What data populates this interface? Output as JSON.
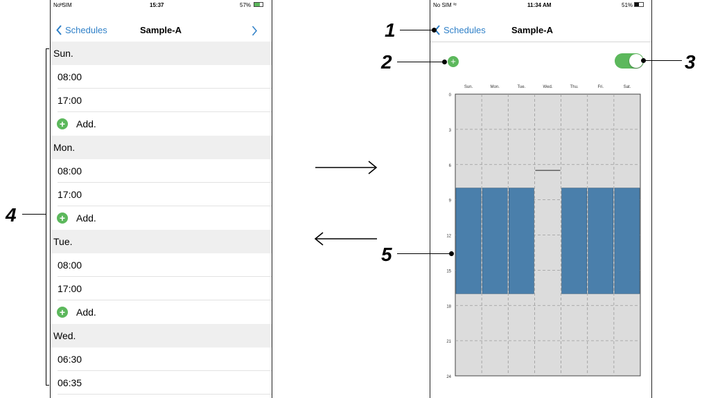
{
  "left_screen": {
    "status": {
      "carrier": "No SIM",
      "time": "15:37",
      "battery": "57%"
    },
    "nav": {
      "back_label": "Schedules",
      "title": "Sample-A"
    },
    "days": [
      {
        "name": "Sun.",
        "times": [
          "08:00",
          "17:00"
        ],
        "add_label": "Add."
      },
      {
        "name": "Mon.",
        "times": [
          "08:00",
          "17:00"
        ],
        "add_label": "Add."
      },
      {
        "name": "Tue.",
        "times": [
          "08:00",
          "17:00"
        ],
        "add_label": "Add."
      },
      {
        "name": "Wed.",
        "times": [
          "06:30",
          "06:35"
        ]
      }
    ]
  },
  "right_screen": {
    "status": {
      "carrier": "No SIM",
      "time": "11:34 AM",
      "battery": "51%"
    },
    "nav": {
      "back_label": "Schedules",
      "title": "Sample-A"
    },
    "toggle_on": true,
    "colors": {
      "accent": "#2f80c8",
      "green": "#5cb85c",
      "block": "#4a7fab",
      "grid_bg": "#dcdcdc"
    }
  },
  "callouts": {
    "c1": "1",
    "c2": "2",
    "c3": "3",
    "c4": "4",
    "c5": "5"
  },
  "chart_data": {
    "type": "heatmap",
    "categories": [
      "Sun.",
      "Mon.",
      "Tue.",
      "Wed.",
      "Thu.",
      "Fri.",
      "Sat."
    ],
    "y_ticks": [
      "0",
      "3",
      "6",
      "9",
      "12",
      "15",
      "18",
      "21",
      "24"
    ],
    "ylim": [
      0,
      24
    ],
    "grid": true,
    "blocks": [
      {
        "day": "Sun.",
        "start": 8,
        "end": 17
      },
      {
        "day": "Mon.",
        "start": 8,
        "end": 17
      },
      {
        "day": "Tue.",
        "start": 8,
        "end": 17
      },
      {
        "day": "Wed.",
        "start": 6.5,
        "end": 6.58
      },
      {
        "day": "Thu.",
        "start": 8,
        "end": 17
      },
      {
        "day": "Fri.",
        "start": 8,
        "end": 17
      },
      {
        "day": "Sat.",
        "start": 8,
        "end": 17
      }
    ]
  }
}
